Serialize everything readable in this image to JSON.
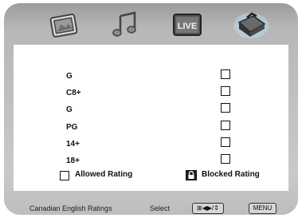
{
  "tabs": [
    {
      "icon": "picture-icon"
    },
    {
      "icon": "music-note-icon"
    },
    {
      "icon": "live-tv-icon",
      "label": "LIVE"
    },
    {
      "icon": "settings-toolbox-icon"
    }
  ],
  "ratings": [
    {
      "label": "G",
      "checked": false
    },
    {
      "label": "C8+",
      "checked": false
    },
    {
      "label": "G",
      "checked": false
    },
    {
      "label": "PG",
      "checked": false
    },
    {
      "label": "14+",
      "checked": false
    },
    {
      "label": "18+",
      "checked": false
    }
  ],
  "legend": {
    "allowed_label": "Allowed Rating",
    "blocked_label": "Blocked Rating"
  },
  "footer": {
    "title": "Canadian English Ratings",
    "select_label": "Select",
    "nav_key_label": "⊞◀▶/⇕",
    "menu_key_label": "MENU"
  }
}
